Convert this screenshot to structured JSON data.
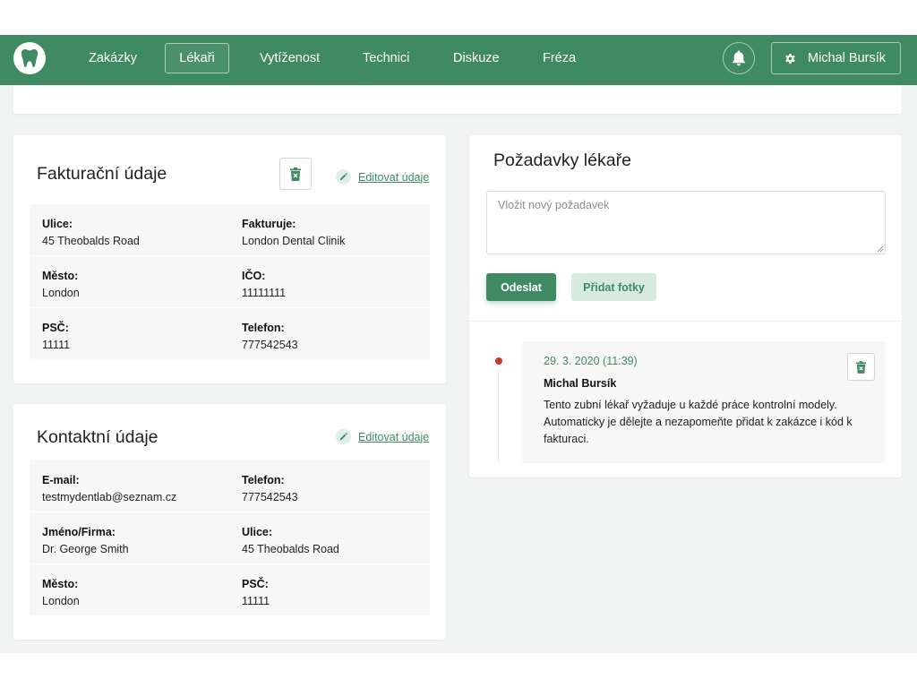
{
  "nav": {
    "items": [
      {
        "label": "Zakázky",
        "active": false
      },
      {
        "label": "Lékaři",
        "active": true
      },
      {
        "label": "Vytíženost",
        "active": false
      },
      {
        "label": "Technici",
        "active": false
      },
      {
        "label": "Diskuze",
        "active": false
      },
      {
        "label": "Fréza",
        "active": false
      }
    ],
    "user_name": "Michal Bursík",
    "colors": {
      "primary": "#3f8a62",
      "danger": "#c0392b"
    }
  },
  "billing": {
    "title": "Fakturační údaje",
    "edit_label": "Editovat údaje",
    "rows": [
      [
        {
          "label": "Ulice:",
          "value": "45 Theobalds Road"
        },
        {
          "label": "Fakturuje:",
          "value": "London Dental Clinik"
        }
      ],
      [
        {
          "label": "Město:",
          "value": "London"
        },
        {
          "label": "IČO:",
          "value": "11111111"
        }
      ],
      [
        {
          "label": "PSČ:",
          "value": "11111"
        },
        {
          "label": "Telefon:",
          "value": "777542543"
        }
      ]
    ]
  },
  "contact": {
    "title": "Kontaktní údaje",
    "edit_label": "Editovat údaje",
    "rows": [
      [
        {
          "label": "E-mail:",
          "value": "testmydentlab@seznam.cz"
        },
        {
          "label": "Telefon:",
          "value": "777542543"
        }
      ],
      [
        {
          "label": "Jméno/Firma:",
          "value": "Dr. George Smith"
        },
        {
          "label": "Ulice:",
          "value": "45 Theobalds Road"
        }
      ],
      [
        {
          "label": "Město:",
          "value": "London"
        },
        {
          "label": "PSČ:",
          "value": "11111"
        }
      ]
    ]
  },
  "requests": {
    "title": "Požadavky lékaře",
    "input_placeholder": "Vložit nový požadavek",
    "input_value": "",
    "send_label": "Odeslat",
    "photo_label": "Přidat fotky",
    "entries": [
      {
        "date": "29. 3. 2020 (11:39)",
        "author": "Michal Bursík",
        "text": "Tento zubní lékař vyžaduje u každé práce kontrolní modely. Automaticky je dělejte a nezapomeňte přidat k zakázce i kód k fakturaci."
      }
    ]
  }
}
